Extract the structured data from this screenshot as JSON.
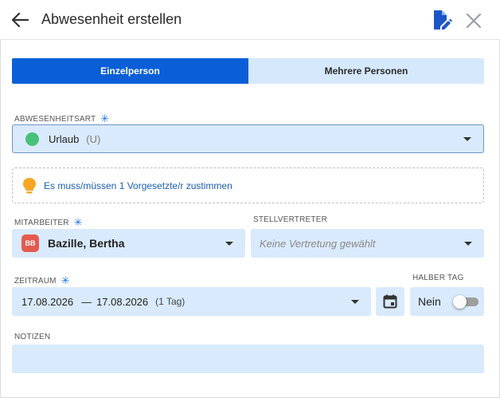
{
  "header": {
    "title": "Abwesenheit erstellen"
  },
  "segment": {
    "active_label": "Einzelperson",
    "inactive_label": "Mehrere Personen"
  },
  "absence_type": {
    "label": "ABWESENHEITSART",
    "required_mark": "✳",
    "value": "Urlaub",
    "code": "(U)",
    "dot_color": "#47c17a"
  },
  "hint": {
    "text": "Es muss/müssen 1 Vorgesetzte/r zustimmen"
  },
  "employee": {
    "label": "MITARBEITER",
    "required_mark": "✳",
    "initials": "BB",
    "value": "Bazille, Bertha"
  },
  "substitute": {
    "label": "STELLVERTRETER",
    "placeholder": "Keine Vertretung gewählt"
  },
  "period": {
    "label": "ZEITRAUM",
    "required_mark": "✳",
    "start": "17.08.2026",
    "separator": "—",
    "end": "17.08.2026",
    "duration": "(1 Tag)"
  },
  "half_day": {
    "label": "HALBER TAG",
    "value": "Nein",
    "enabled": false
  },
  "notes": {
    "label": "NOTIZEN",
    "value": ""
  },
  "colors": {
    "accent": "#0a5fd8",
    "field_bg": "#d9eafc",
    "hint_icon": "#f5a623"
  }
}
